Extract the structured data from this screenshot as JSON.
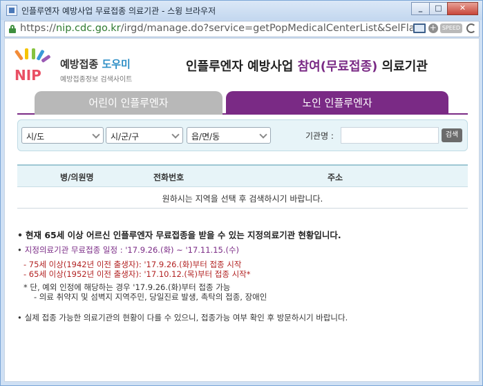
{
  "window": {
    "title": "인플루엔자 예방사업 무료접종 의료기관 - 스윙 브라우저",
    "minimize_glyph": "_",
    "maximize_glyph": "□",
    "close_glyph": "✕"
  },
  "address_bar": {
    "scheme": "https://",
    "host": "nip.cdc.go.kr",
    "path": "/irgd/manage.do?service=getPopMedicalCenterList&SelFlag=",
    "speed_label": "SPEED"
  },
  "header": {
    "logo_main": "예방접종",
    "logo_accent": "도우미",
    "logo_sub": "예방접종정보 검색사이트",
    "logo_letters": "NIP",
    "title_prefix": "인플루엔자 예방사업 ",
    "title_highlight": "참여(무료접종)",
    "title_suffix": " 의료기관"
  },
  "tabs": {
    "child": "어린이 인플루엔자",
    "elder": "노인 인플루엔자"
  },
  "search": {
    "sido": "시/도",
    "sigungu": "시/군/구",
    "eupmyeondong": "읍/면/동",
    "institution_label": "기관명 :",
    "institution_value": "",
    "search_button": "검색"
  },
  "table": {
    "columns": [
      "병/의원명",
      "전화번호",
      "주소"
    ],
    "empty_message": "원하시는 지역을 선택 후 검색하시기 바랍니다."
  },
  "notes": {
    "headline": "현재 65세 이상 어르신 인플루엔자 무료접종을 받을 수 있는 지정의료기관 현황입니다.",
    "period": "지정의료기관 무료접종 일정 : '17.9.26.(화) ~ '17.11.15.(수)",
    "age75": "- 75세 이상(1942년 이전 출생자): '17.9.26.(화)부터 접종 시작",
    "age65": "- 65세 이상(1952년 이전 출생자): '17.10.12.(목)부터 접종 시작*",
    "exception": "* 단, 예외 인정에 해당하는 경우 '17.9.26.(화)부터 접종 가능",
    "exception_detail": "- 의료 취약지 및 섬벽지 지역주민, 당일진료 발생, 촉탁의 접종, 장애인",
    "final": "실제 접종 가능한 의료기관의 현황이 다를 수 있으니, 접종가능 여부 확인 후 방문하시기 바랍니다."
  }
}
